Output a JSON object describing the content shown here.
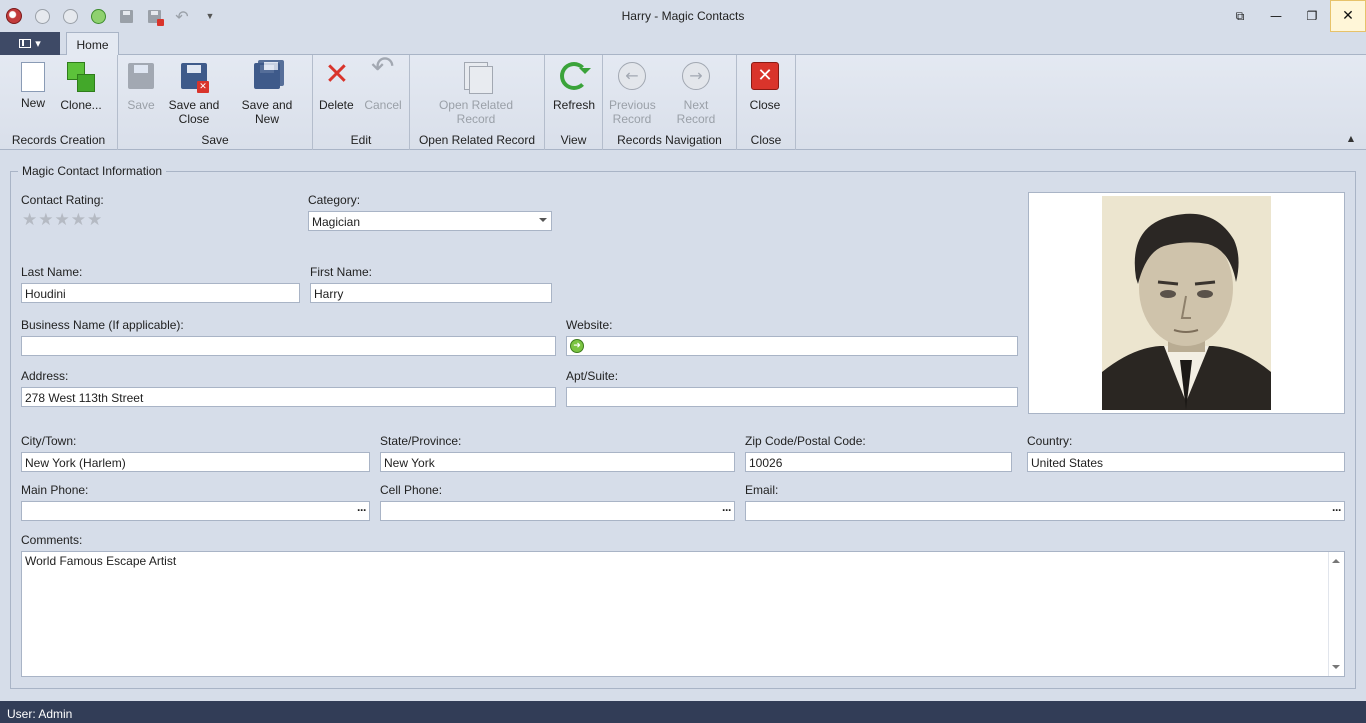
{
  "window": {
    "title": "Harry - Magic Contacts",
    "controls": {
      "restore": "⧉",
      "minimize": "—",
      "maximize": "❐",
      "close": "✕"
    }
  },
  "tabs": {
    "home": "Home"
  },
  "ribbon": {
    "groups": {
      "records_creation": "Records Creation",
      "save": "Save",
      "edit": "Edit",
      "open_related": "Open Related Record",
      "view": "View",
      "records_navigation": "Records Navigation",
      "close": "Close"
    },
    "buttons": {
      "new": "New",
      "clone": "Clone...",
      "save": "Save",
      "save_and_close_1": "Save and",
      "save_and_close_2": "Close",
      "save_and_new": "Save and New",
      "delete": "Delete",
      "cancel": "Cancel",
      "open_related_1": "Open Related",
      "open_related_2": "Record",
      "refresh": "Refresh",
      "previous_1": "Previous",
      "previous_2": "Record",
      "next": "Next Record",
      "close": "Close"
    }
  },
  "form": {
    "section_title": "Magic Contact Information",
    "contact_rating": {
      "label": "Contact Rating:",
      "value": 0,
      "max": 5,
      "glyphs": "★★★★★"
    },
    "category": {
      "label": "Category:",
      "value": "Magician"
    },
    "last_name": {
      "label": "Last Name:",
      "value": "Houdini"
    },
    "first_name": {
      "label": "First Name:",
      "value": "Harry"
    },
    "business_name": {
      "label": "Business Name (If applicable):",
      "value": ""
    },
    "website": {
      "label": "Website:",
      "value": ""
    },
    "address": {
      "label": "Address:",
      "value": "278 West 113th Street"
    },
    "apt_suite": {
      "label": "Apt/Suite:",
      "value": ""
    },
    "city": {
      "label": "City/Town:",
      "value": "New York (Harlem)"
    },
    "state": {
      "label": "State/Province:",
      "value": "New York"
    },
    "zip": {
      "label": "Zip Code/Postal Code:",
      "value": "10026"
    },
    "country": {
      "label": "Country:",
      "value": "United States"
    },
    "main_phone": {
      "label": "Main Phone:",
      "value": ""
    },
    "cell_phone": {
      "label": "Cell Phone:",
      "value": ""
    },
    "email": {
      "label": "Email:",
      "value": ""
    },
    "comments": {
      "label": "Comments:",
      "value": "World Famous Escape Artist"
    },
    "ellipsis": "···"
  },
  "status": {
    "user": "User: Admin"
  },
  "colors": {
    "statusbar": "#323d57",
    "background": "#d6dde9",
    "danger": "#d9342b",
    "accent_green": "#3aa33a"
  }
}
